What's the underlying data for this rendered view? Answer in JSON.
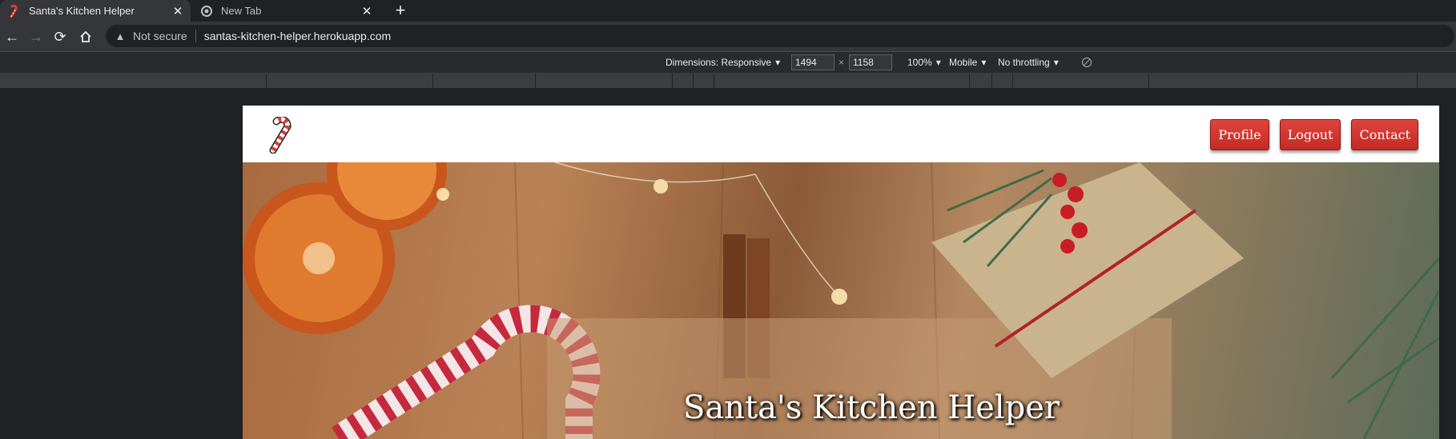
{
  "browser": {
    "tabs": [
      {
        "title": "Santa's Kitchen Helper",
        "active": true
      },
      {
        "title": "New Tab",
        "active": false
      }
    ],
    "address": {
      "security_label": "Not secure",
      "url": "santas-kitchen-helper.herokuapp.com"
    }
  },
  "devtools": {
    "dimensions_label": "Dimensions: Responsive",
    "width": "1494",
    "height": "1158",
    "times": "×",
    "zoom": "100%",
    "device": "Mobile",
    "throttling": "No throttling"
  },
  "site": {
    "nav": {
      "logo": "candy-cane-icon",
      "buttons": [
        "Profile",
        "Logout",
        "Contact"
      ]
    },
    "hero": {
      "title": "Santa's Kitchen Helper"
    }
  },
  "colors": {
    "button": "#d23a33",
    "chrome_dark": "#202124",
    "chrome_mid": "#35363a"
  }
}
